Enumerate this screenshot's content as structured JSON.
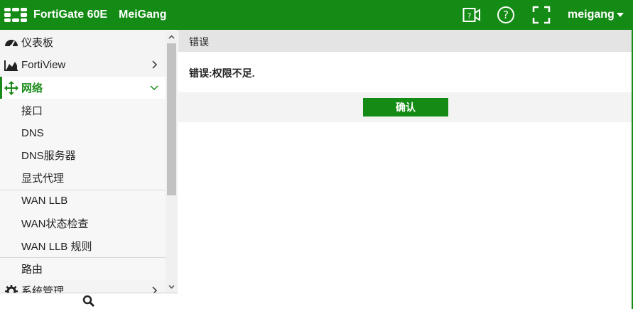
{
  "header": {
    "product": "FortiGate 60E",
    "hostname": "MeiGang",
    "user": "meigang",
    "icons": [
      "cli-console-icon",
      "help-icon",
      "fullscreen-icon"
    ]
  },
  "sidebar": {
    "items": [
      {
        "label": "仪表板",
        "icon": "dashboard-icon",
        "level": "top"
      },
      {
        "label": "FortiView",
        "icon": "fortiview-chart-icon",
        "level": "top",
        "chevron": "right"
      },
      {
        "label": "网络",
        "icon": "network-move-icon",
        "level": "top",
        "chevron": "down",
        "active": true
      },
      {
        "label": "接口",
        "level": "sub"
      },
      {
        "label": "DNS",
        "level": "sub"
      },
      {
        "label": "DNS服务器",
        "level": "sub"
      },
      {
        "label": "显式代理",
        "level": "sub"
      },
      {
        "label": "WAN LLB",
        "level": "sub"
      },
      {
        "label": "WAN状态检查",
        "level": "sub"
      },
      {
        "label": "WAN LLB 规则",
        "level": "sub"
      },
      {
        "label": "路由",
        "level": "sub"
      },
      {
        "label": "系统管理",
        "icon": "gear-icon",
        "level": "top",
        "chevron": "right"
      }
    ],
    "search_icon": "search-icon"
  },
  "dialog": {
    "title": "错误",
    "message": "错误:权限不足.",
    "ok_label": "确认"
  },
  "colors": {
    "brand_green": "#148b14",
    "active_text": "#1a8a1a"
  }
}
